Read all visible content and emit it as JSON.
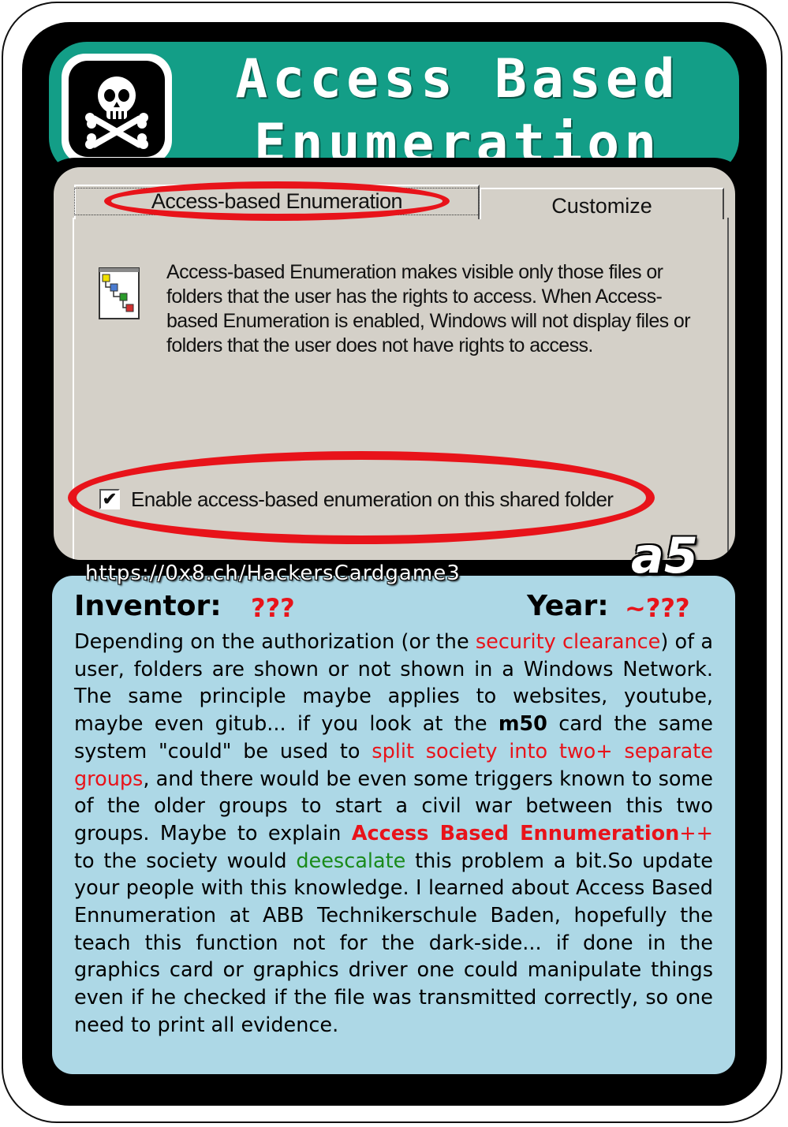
{
  "card": {
    "title_line1": "Access Based",
    "title_line2": "Enumeration",
    "icon": "skull-crossbones-icon",
    "card_id": "a5",
    "url": "https://0x8.ch/HackersCardgame3",
    "colors": {
      "title_bar": "#139e87",
      "info_panel": "#add8e6",
      "highlight": "#e8131a",
      "positive": "#1a8a1a"
    }
  },
  "screenshot": {
    "tab_active": "Access-based Enumeration",
    "tab_inactive": "Customize",
    "description": "Access-based Enumeration makes visible only those files or folders that the user has the rights to access. When Access-based Enumeration is enabled, Windows will not display files or folders that the user does not have rights to access.",
    "checkbox_checked": true,
    "checkbox_mark": "✔",
    "checkbox_label": "Enable access-based enumeration on this shared folder"
  },
  "info": {
    "inventor_label": "Inventor:",
    "inventor_value": "???",
    "year_label": "Year:",
    "year_value": "~???",
    "body": {
      "p1": "Depending on the authorization (or the ",
      "p2": "security clearance",
      "p3": ") of a user, folders are shown or not shown in a Windows Network. The same principle maybe applies to websites, youtube, maybe even gitub... if you look at the ",
      "p4": "m50",
      "p5": " card the same system \"could\" be used to ",
      "p6": "split society into two+ separate groups",
      "p7": ", and there would be even some triggers known to some of the older groups to start a civil war between this two groups. Maybe to explain ",
      "p8": "Access Based Ennumeration",
      "p9": "++",
      "p10": " to the society would ",
      "p11": "deescalate",
      "p12": " this problem a bit.So update your people with this knowledge. I learned about Access Based Ennumeration at ABB Technikerschule Baden, hopefully the teach this function not for the dark-side... if done in the graphics card or graphics driver one could manipulate things even if he checked if the file was transmitted correctly, so one need to print all evidence."
    }
  }
}
